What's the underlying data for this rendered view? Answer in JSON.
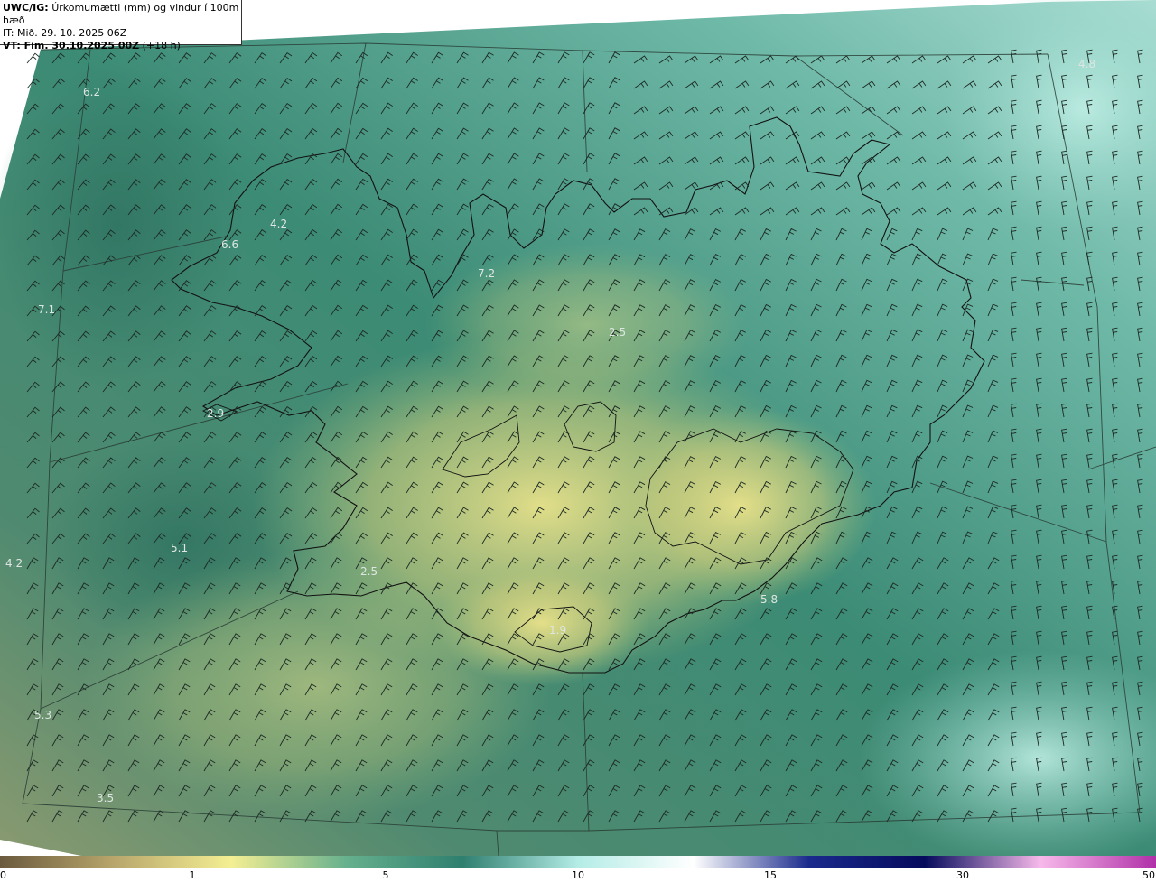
{
  "header": {
    "model": "UWC/IG:",
    "title": "Úrkomumætti (mm) og vindur í 100m hæð",
    "it": "IT: Mið. 29. 10. 2025 06Z",
    "vt_label": "VT: Fim. 30.10.2025 00Z",
    "vt_lead": "(+18 h)"
  },
  "values": [
    {
      "text": "6.2"
    },
    {
      "text": "4.8"
    },
    {
      "text": "4.2"
    },
    {
      "text": "6.6"
    },
    {
      "text": "7.2"
    },
    {
      "text": "7.1"
    },
    {
      "text": "2.5"
    },
    {
      "text": "2.9"
    },
    {
      "text": "5.1"
    },
    {
      "text": "4.2"
    },
    {
      "text": "2.5"
    },
    {
      "text": "5.8"
    },
    {
      "text": "5.3"
    },
    {
      "text": "3.5"
    },
    {
      "text": "1.9"
    }
  ],
  "colorbar": {
    "ticks": [
      "0",
      "1",
      "5",
      "10",
      "15",
      "30",
      "50"
    ],
    "colors": [
      "#6b5a3e",
      "#b9a76c",
      "#f4ef93",
      "#66b08e",
      "#2f7f6f",
      "#b4ece6",
      "#ffffff",
      "#1a2a8c",
      "#050a5c",
      "#f7b9ea",
      "#b030a8"
    ]
  }
}
